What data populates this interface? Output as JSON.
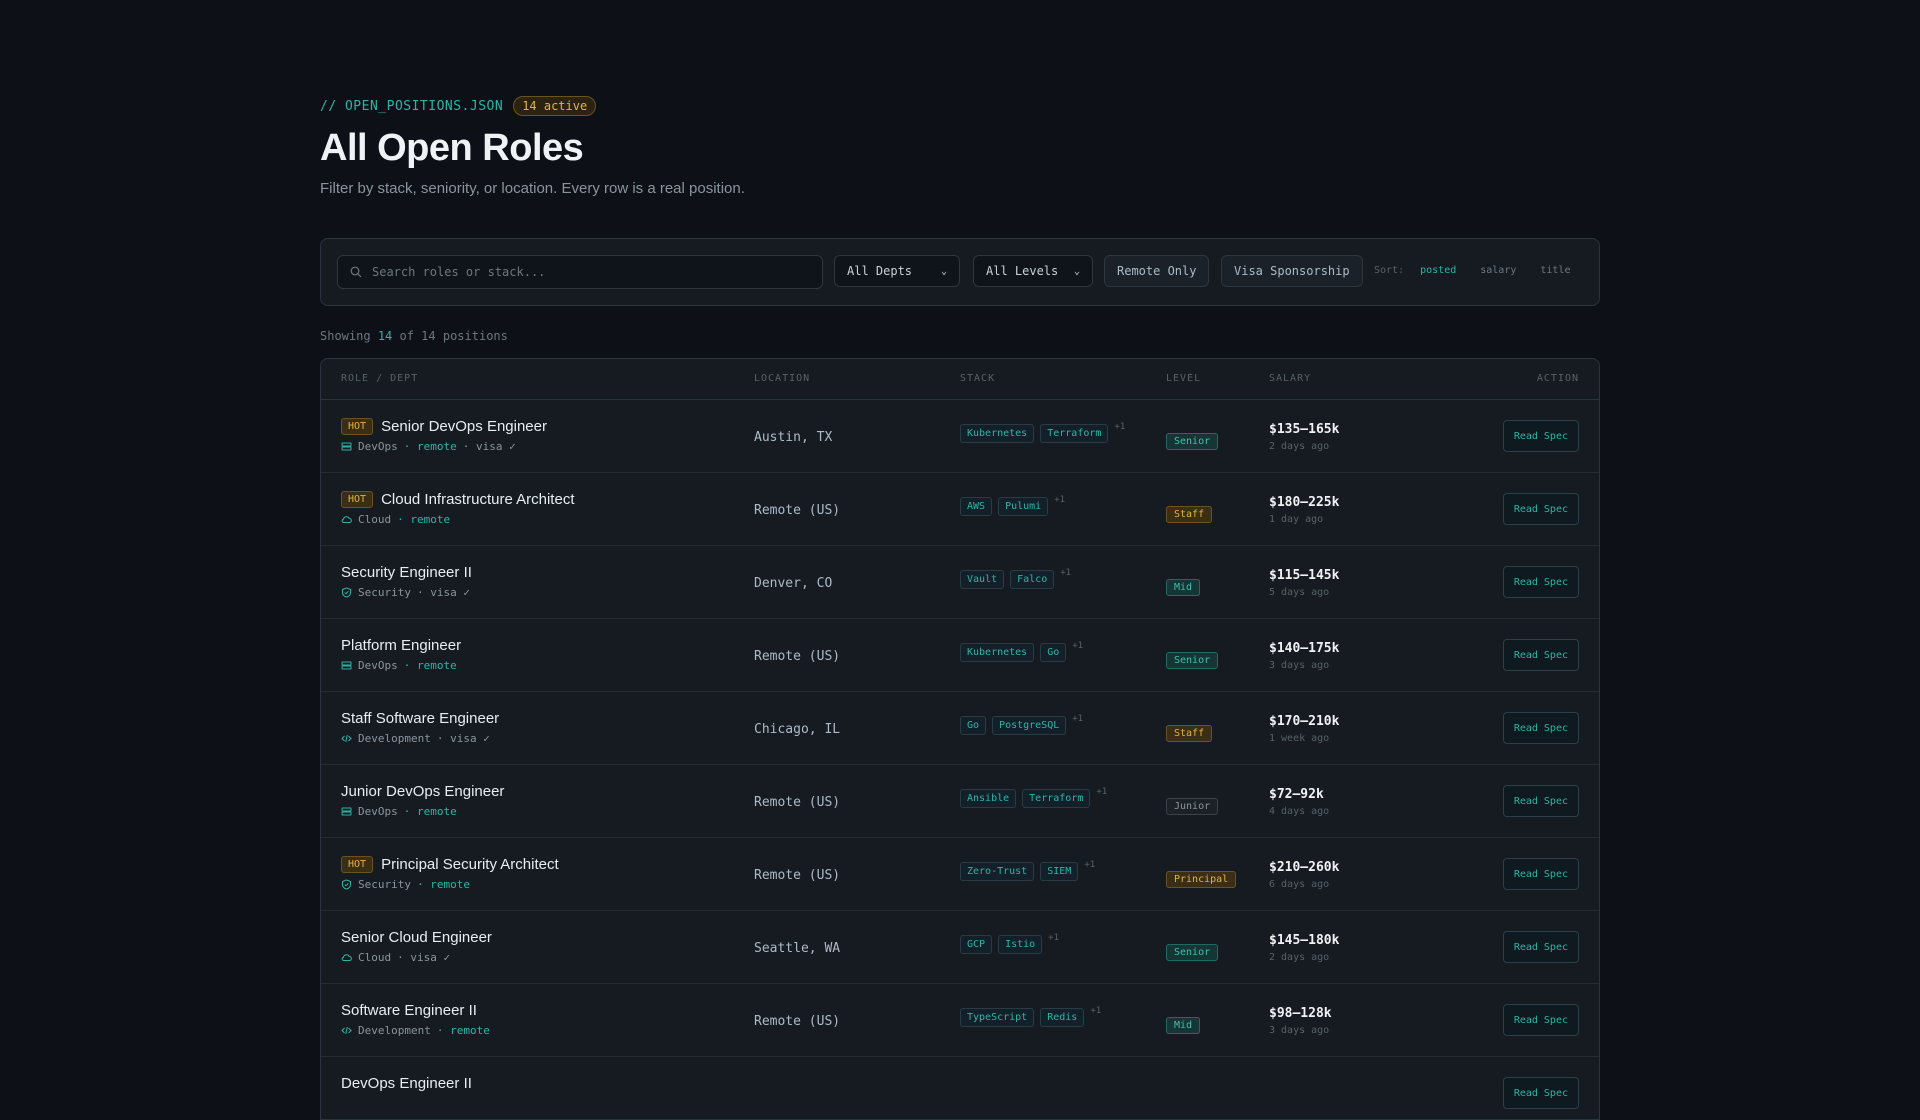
{
  "header": {
    "path": "// OPEN_POSITIONS.JSON",
    "active_badge": "14 active",
    "title": "All Open Roles",
    "subtitle": "Filter by stack, seniority, or location. Every row is a real position."
  },
  "filters": {
    "search_placeholder": "Search roles or stack...",
    "dept": "All Depts",
    "level": "All Levels",
    "remote_only": "Remote Only",
    "visa": "Visa Sponsorship",
    "sort_label": "Sort:",
    "sort_options": [
      "posted",
      "salary",
      "title"
    ],
    "sort_active": "posted"
  },
  "showing": {
    "prefix": "Showing",
    "count": "14",
    "suffix": "of 14 positions"
  },
  "table": {
    "columns": [
      "ROLE / DEPT",
      "LOCATION",
      "STACK",
      "LEVEL",
      "SALARY",
      "ACTION"
    ],
    "rows": [
      {
        "hot": "HOT",
        "title": "Senior DevOps Engineer",
        "dept": "DevOps",
        "dept_icon": "server-icon",
        "remote": "· remote",
        "visa": "· visa ✓",
        "location": "Austin, TX",
        "stack": [
          "Kubernetes",
          "Terraform"
        ],
        "more": "+1",
        "level": "Senior",
        "level_class": "senior",
        "salary": "$135–165k",
        "posted": "2 days ago",
        "action": "Read Spec"
      },
      {
        "hot": "HOT",
        "title": "Cloud Infrastructure Architect",
        "dept": "Cloud",
        "dept_icon": "cloud-icon",
        "remote": "· remote",
        "visa": "",
        "location": "Remote (US)",
        "stack": [
          "AWS",
          "Pulumi"
        ],
        "more": "+1",
        "level": "Staff",
        "level_class": "staff",
        "salary": "$180–225k",
        "posted": "1 day ago",
        "action": "Read Spec"
      },
      {
        "hot": "",
        "title": "Security Engineer II",
        "dept": "Security",
        "dept_icon": "shield-icon",
        "remote": "",
        "visa": "· visa ✓",
        "location": "Denver, CO",
        "stack": [
          "Vault",
          "Falco"
        ],
        "more": "+1",
        "level": "Mid",
        "level_class": "mid",
        "salary": "$115–145k",
        "posted": "5 days ago",
        "action": "Read Spec"
      },
      {
        "hot": "",
        "title": "Platform Engineer",
        "dept": "DevOps",
        "dept_icon": "server-icon",
        "remote": "· remote",
        "visa": "",
        "location": "Remote (US)",
        "stack": [
          "Kubernetes",
          "Go"
        ],
        "more": "+1",
        "level": "Senior",
        "level_class": "senior",
        "salary": "$140–175k",
        "posted": "3 days ago",
        "action": "Read Spec"
      },
      {
        "hot": "",
        "title": "Staff Software Engineer",
        "dept": "Development",
        "dept_icon": "code-icon",
        "remote": "",
        "visa": "· visa ✓",
        "location": "Chicago, IL",
        "stack": [
          "Go",
          "PostgreSQL"
        ],
        "more": "+1",
        "level": "Staff",
        "level_class": "staff",
        "salary": "$170–210k",
        "posted": "1 week ago",
        "action": "Read Spec"
      },
      {
        "hot": "",
        "title": "Junior DevOps Engineer",
        "dept": "DevOps",
        "dept_icon": "server-icon",
        "remote": "· remote",
        "visa": "",
        "location": "Remote (US)",
        "stack": [
          "Ansible",
          "Terraform"
        ],
        "more": "+1",
        "level": "Junior",
        "level_class": "junior",
        "salary": "$72–92k",
        "posted": "4 days ago",
        "action": "Read Spec"
      },
      {
        "hot": "HOT",
        "title": "Principal Security Architect",
        "dept": "Security",
        "dept_icon": "shield-icon",
        "remote": "· remote",
        "visa": "",
        "location": "Remote (US)",
        "stack": [
          "Zero-Trust",
          "SIEM"
        ],
        "more": "+1",
        "level": "Principal",
        "level_class": "principal",
        "salary": "$210–260k",
        "posted": "6 days ago",
        "action": "Read Spec"
      },
      {
        "hot": "",
        "title": "Senior Cloud Engineer",
        "dept": "Cloud",
        "dept_icon": "cloud-icon",
        "remote": "",
        "visa": "· visa ✓",
        "location": "Seattle, WA",
        "stack": [
          "GCP",
          "Istio"
        ],
        "more": "+1",
        "level": "Senior",
        "level_class": "senior",
        "salary": "$145–180k",
        "posted": "2 days ago",
        "action": "Read Spec"
      },
      {
        "hot": "",
        "title": "Software Engineer II",
        "dept": "Development",
        "dept_icon": "code-icon",
        "remote": "· remote",
        "visa": "",
        "location": "Remote (US)",
        "stack": [
          "TypeScript",
          "Redis"
        ],
        "more": "+1",
        "level": "Mid",
        "level_class": "mid",
        "salary": "$98–128k",
        "posted": "3 days ago",
        "action": "Read Spec"
      },
      {
        "hot": "",
        "title": "DevOps Engineer II",
        "dept": "",
        "dept_icon": "",
        "remote": "",
        "visa": "",
        "location": "",
        "stack": [],
        "more": "",
        "level": "",
        "level_class": "",
        "salary": "",
        "posted": "",
        "action": "Read Spec"
      }
    ]
  }
}
